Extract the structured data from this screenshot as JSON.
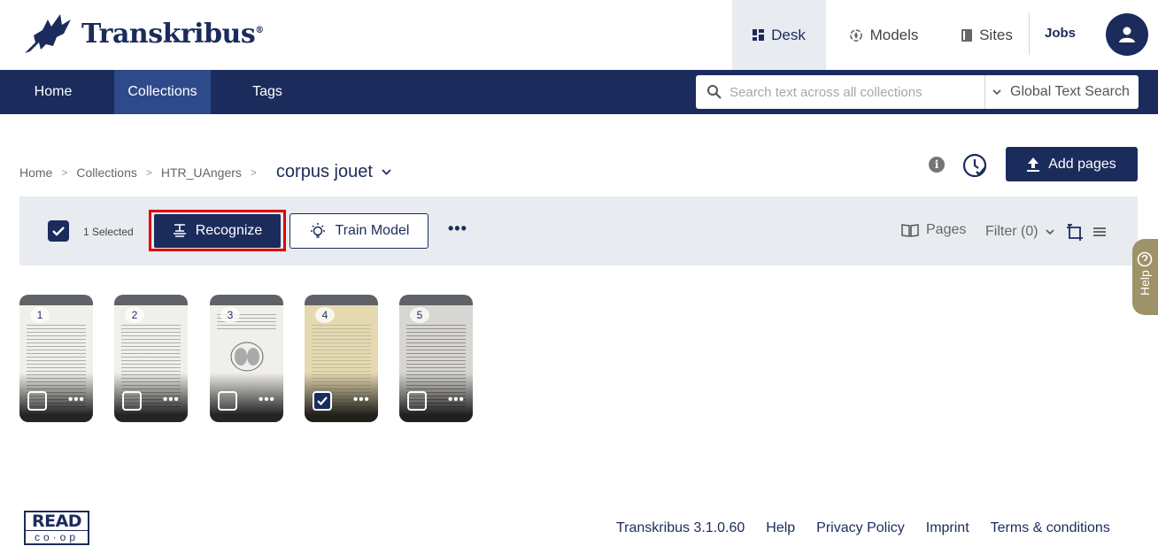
{
  "header": {
    "brand": "Transkribus",
    "brand_mark": "®",
    "nav": [
      {
        "label": "Desk",
        "icon": "dashboard-icon",
        "active": true
      },
      {
        "label": "Models",
        "icon": "models-icon",
        "active": false
      },
      {
        "label": "Sites",
        "icon": "sites-icon",
        "active": false
      }
    ],
    "jobs_label": "Jobs",
    "avatar_icon": "user-icon"
  },
  "navbar": {
    "items": [
      {
        "label": "Home",
        "active": false
      },
      {
        "label": "Collections",
        "active": true
      },
      {
        "label": "Tags",
        "active": false
      }
    ],
    "search": {
      "placeholder": "Search text across all collections",
      "value": "",
      "scope": "Global Text Search"
    }
  },
  "breadcrumb": {
    "items": [
      "Home",
      "Collections",
      "HTR_UAngers"
    ],
    "current": "corpus jouet"
  },
  "actions": {
    "add_pages_label": "Add pages"
  },
  "toolbar": {
    "selected_label": "1 Selected",
    "recognize_label": "Recognize",
    "train_label": "Train Model",
    "more_label": "•••",
    "view_label": "Pages",
    "filter_label": "Filter (0)"
  },
  "help": {
    "label": "Help"
  },
  "thumbnails": [
    {
      "number": "1",
      "selected": false,
      "tone": "white"
    },
    {
      "number": "2",
      "selected": false,
      "tone": "white"
    },
    {
      "number": "3",
      "selected": false,
      "tone": "white"
    },
    {
      "number": "4",
      "selected": true,
      "tone": "yellow"
    },
    {
      "number": "5",
      "selected": false,
      "tone": "gray"
    }
  ],
  "footer": {
    "logo_top": "READ",
    "logo_bottom": "co·op",
    "version": "Transkribus 3.1.0.60",
    "links": [
      "Help",
      "Privacy Policy",
      "Imprint",
      "Terms & conditions"
    ]
  },
  "colors": {
    "brand": "#1b2c5c",
    "nav_active": "#2f4a8a",
    "highlight": "#e00000",
    "help_tab": "#9e9268"
  }
}
